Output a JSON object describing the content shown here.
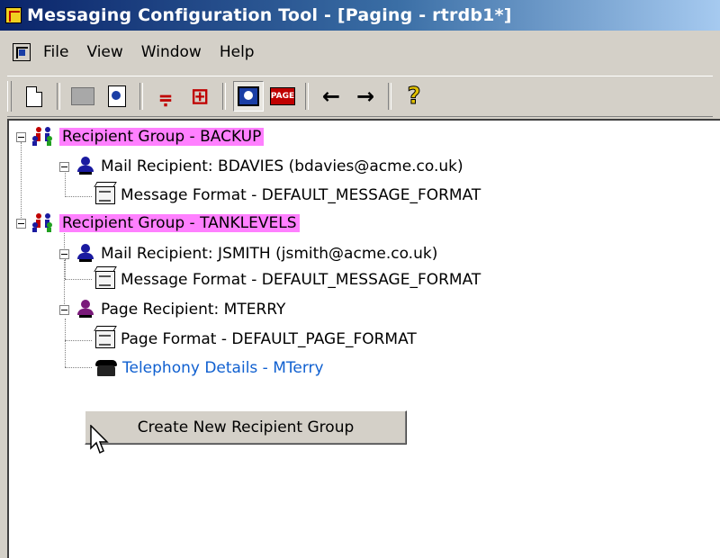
{
  "window": {
    "title": "Messaging Configuration Tool - [Paging - rtrdb1*]"
  },
  "menu": {
    "items": [
      "File",
      "View",
      "Window",
      "Help"
    ]
  },
  "toolbar": {
    "buttons": [
      "new-document-icon",
      "page-gray-icon",
      "document-blue-icon",
      "red-tool-icon",
      "red-tool-2-icon",
      "picture-blue-icon",
      "page-icon",
      "back-arrow-icon",
      "forward-arrow-icon",
      "help-icon"
    ],
    "page_label": "PAGE",
    "back_glyph": "←",
    "forward_glyph": "→",
    "help_glyph": "?"
  },
  "tree": {
    "group_backup": "Recipient Group - BACKUP",
    "mail_bdavies": "Mail Recipient: BDAVIES (bdavies@acme.co.uk)",
    "format_1": "Message Format - DEFAULT_MESSAGE_FORMAT",
    "group_tanklevels": "Recipient Group - TANKLEVELS",
    "mail_jsmith": "Mail Recipient: JSMITH (jsmith@acme.co.uk)",
    "format_2": "Message Format - DEFAULT_MESSAGE_FORMAT",
    "page_mterry": "Page Recipient: MTERRY",
    "page_format": "Page Format - DEFAULT_PAGE_FORMAT",
    "telephony": "Telephony Details - MTerry"
  },
  "actions": {
    "create_group": "Create New Recipient Group"
  },
  "colors": {
    "group_highlight": "#ff80ff",
    "link_text": "#1060d0",
    "titlebar": "#0a246a"
  }
}
